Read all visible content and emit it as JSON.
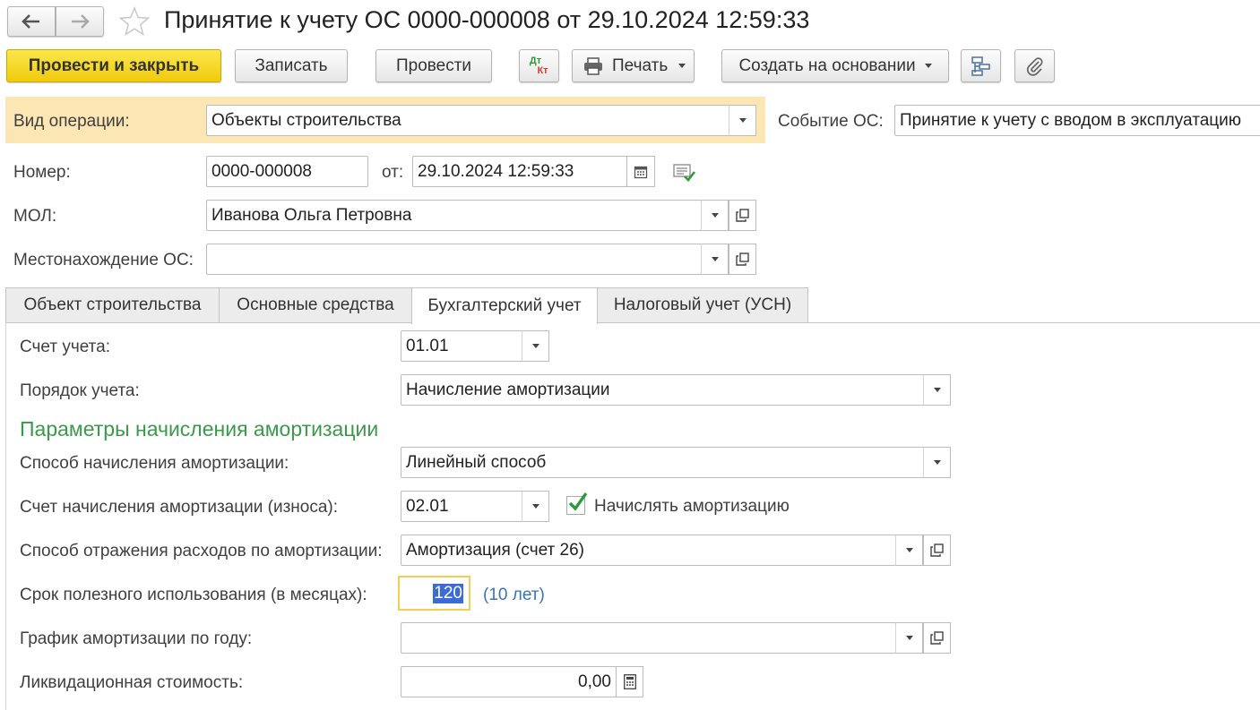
{
  "window": {
    "title": "Принятие к учету ОС 0000-000008 от 29.10.2024 12:59:33"
  },
  "toolbar": {
    "post_close": "Провести и закрыть",
    "save": "Записать",
    "post": "Провести",
    "dtkt_top": "Дт",
    "dtkt_bottom": "Кт",
    "print": "Печать",
    "create_based": "Создать на основании"
  },
  "header": {
    "operation_label": "Вид операции:",
    "operation_value": "Объекты строительства",
    "event_label": "Событие ОС:",
    "event_value": "Принятие к учету с вводом в эксплуатацию",
    "number_label": "Номер:",
    "number_value": "0000-000008",
    "date_label": "от:",
    "date_value": "29.10.2024 12:59:33",
    "mol_label": "МОЛ:",
    "mol_value": "Иванова Ольга Петровна",
    "location_label": "Местонахождение ОС:",
    "location_value": ""
  },
  "tabs": [
    {
      "label": "Объект строительства",
      "active": false
    },
    {
      "label": "Основные средства",
      "active": false
    },
    {
      "label": "Бухгалтерский учет",
      "active": true
    },
    {
      "label": "Налоговый учет (УСН)",
      "active": false
    }
  ],
  "accounting": {
    "account_label": "Счет учета:",
    "account_value": "01.01",
    "order_label": "Порядок учета:",
    "order_value": "Начисление амортизации",
    "section_title": "Параметры начисления амортизации",
    "method_label": "Способ начисления амортизации:",
    "method_value": "Линейный способ",
    "dep_account_label": "Счет начисления амортизации (износа):",
    "dep_account_value": "02.01",
    "accrue_checkbox_label": "Начислять амортизацию",
    "accrue_checked": true,
    "expense_label": "Способ отражения расходов по амортизации:",
    "expense_value": "Амортизация (счет 26)",
    "life_label": "Срок полезного использования (в месяцах):",
    "life_value": "120",
    "life_years": "(10 лет)",
    "schedule_label": "График амортизации по году:",
    "schedule_value": "",
    "liquidation_label": "Ликвидационная стоимость:",
    "liquidation_value": "0,00"
  },
  "colors": {
    "primary_button": "#f5d31c",
    "section_title": "#3a9a4a",
    "highlight_band": "#fbe6b4",
    "selection": "#3d6bd6",
    "link_blue": "#3b73b9"
  }
}
